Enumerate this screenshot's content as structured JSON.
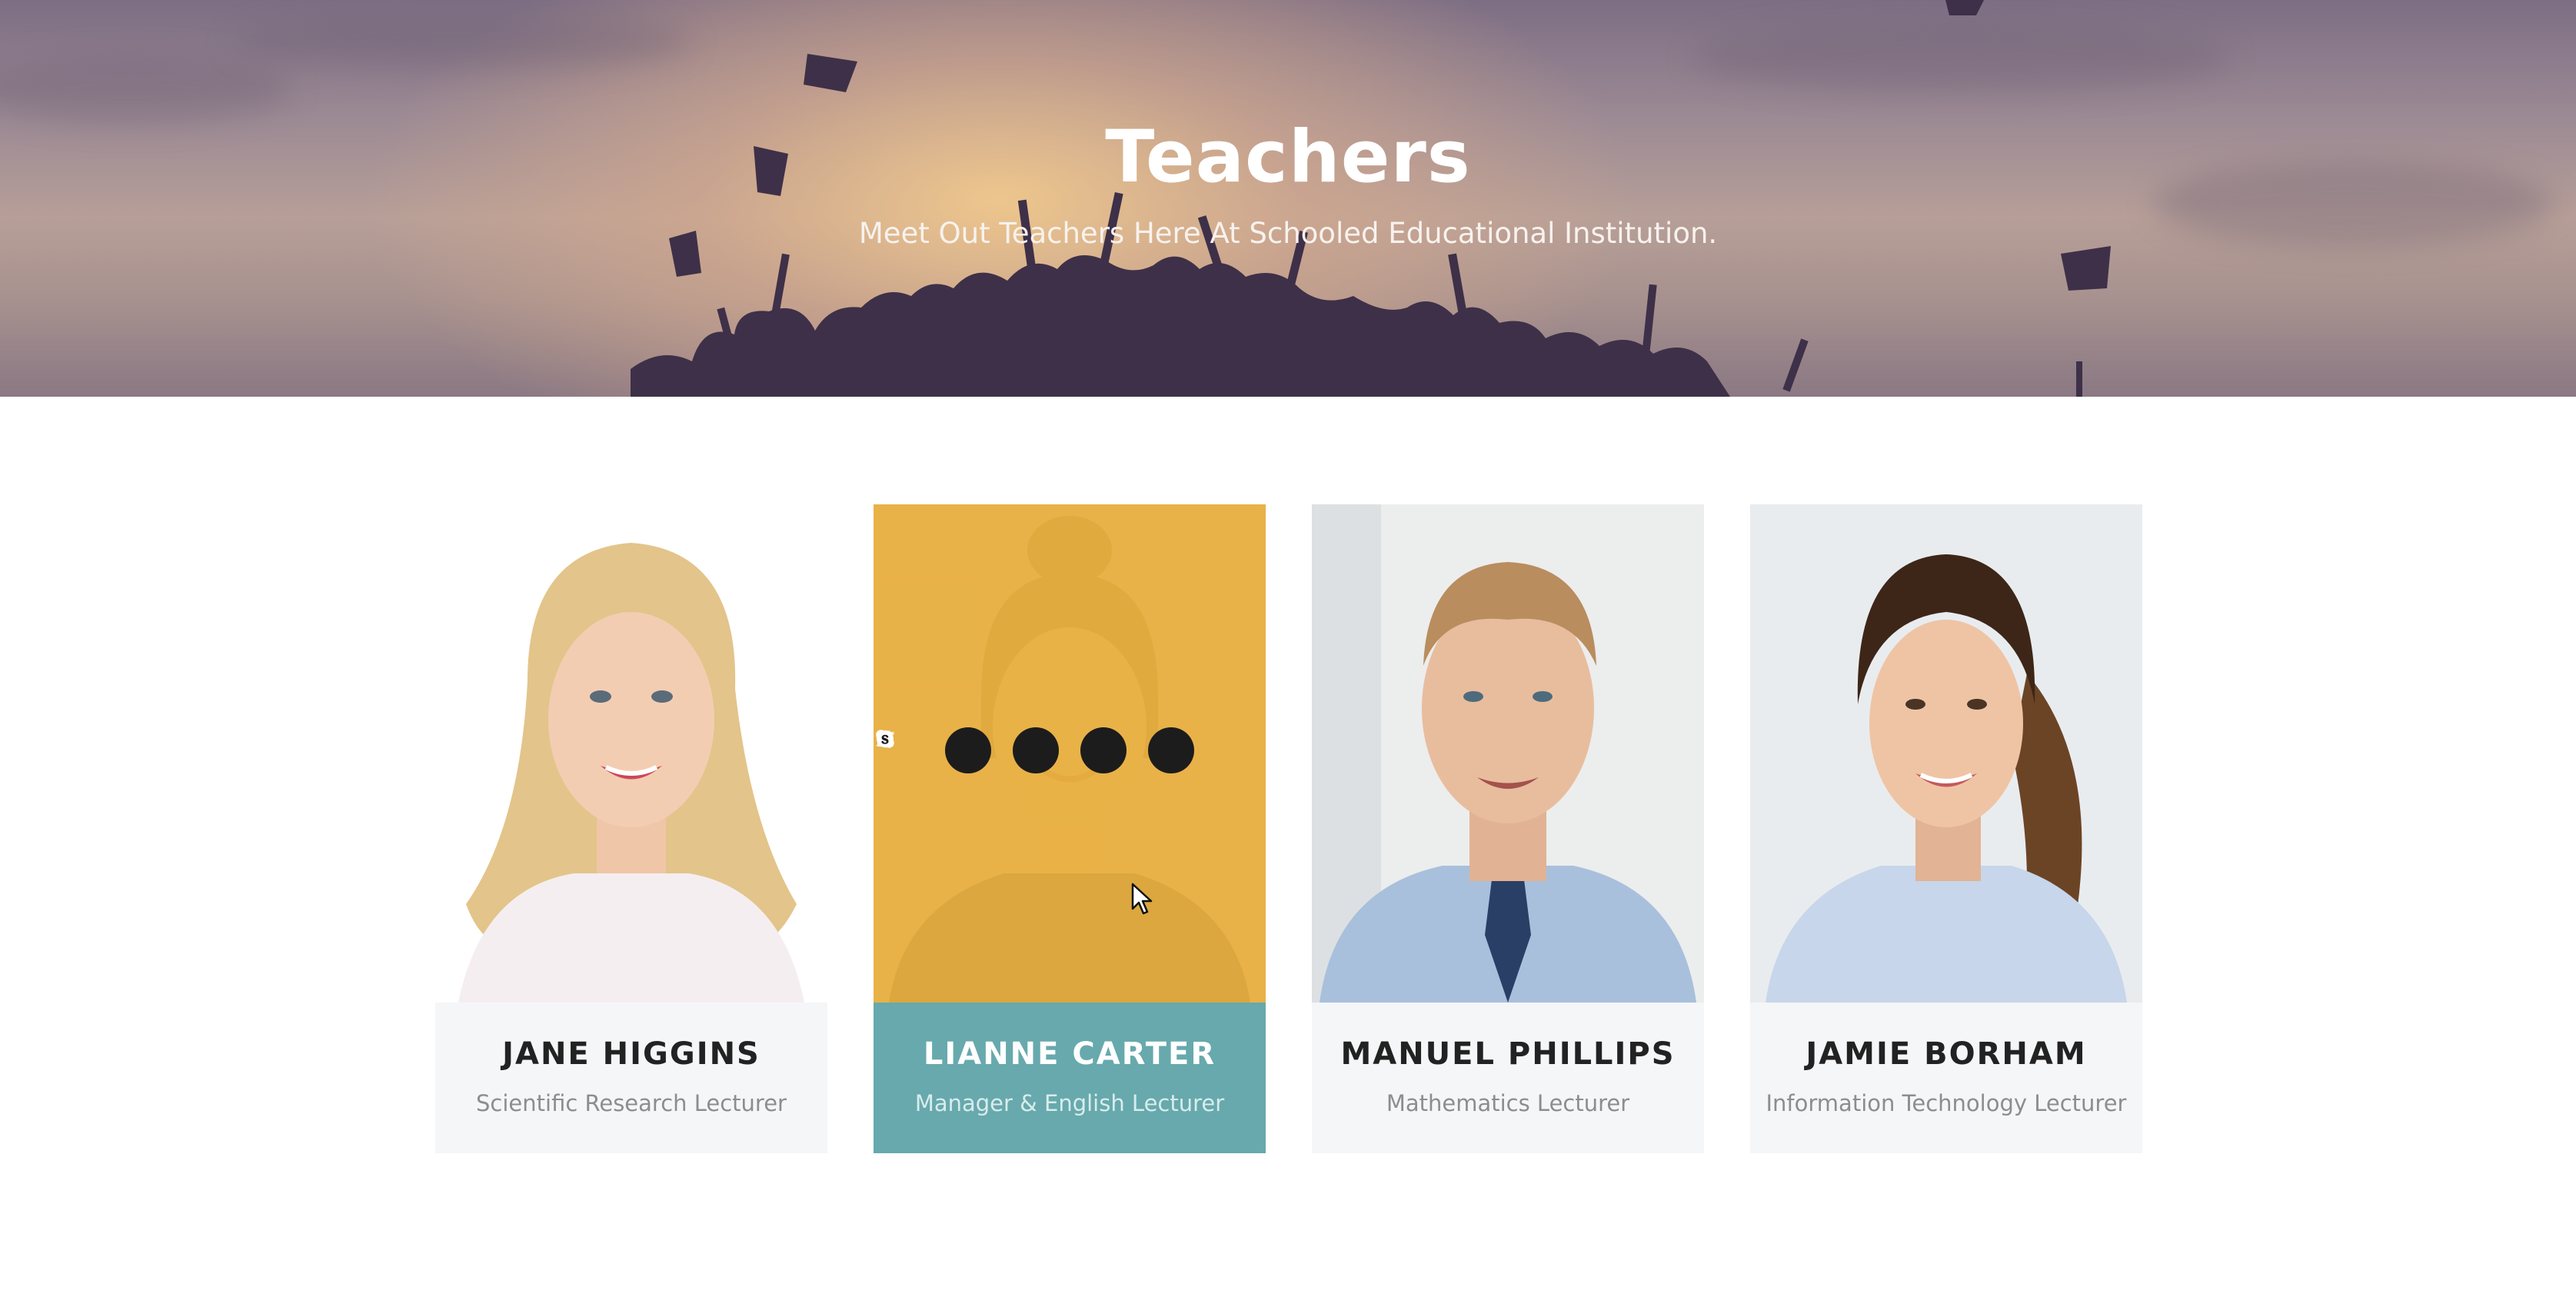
{
  "hero": {
    "title": "Teachers",
    "subtitle": "Meet Out Teachers Here At Schooled Educational Institution."
  },
  "teachers": [
    {
      "name": "JANE HIGGINS",
      "role": "Scientific Research Lecturer",
      "active": false
    },
    {
      "name": "LIANNE CARTER",
      "role": "Manager & English Lecturer",
      "active": true
    },
    {
      "name": "MANUEL PHILLIPS",
      "role": "Mathematics Lecturer",
      "active": false
    },
    {
      "name": "JAMIE BORHAM",
      "role": "Information Technology Lecturer",
      "active": false
    }
  ],
  "social_icons": [
    "facebook-icon",
    "twitter-icon",
    "linkedin-icon",
    "skype-icon"
  ],
  "colors": {
    "accent_yellow": "#e8b040",
    "accent_teal": "#67a9ad",
    "card_bg": "#f5f6f7",
    "dark": "#1c1c1c"
  }
}
